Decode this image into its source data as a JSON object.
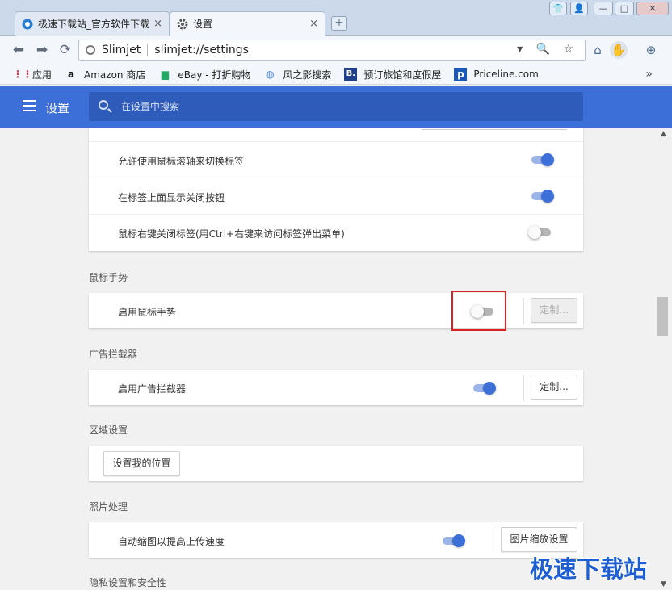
{
  "window": {
    "tabs": [
      {
        "title": "极速下载站_官方软件下载",
        "close": "×"
      },
      {
        "title": "设置",
        "close": "×"
      }
    ],
    "new_tab": "+",
    "controls": {
      "shirt": "👕",
      "user": "👤",
      "minimize": "—",
      "maximize": "□",
      "close": "✕"
    }
  },
  "toolbar": {
    "back": "⬅",
    "forward": "➡",
    "reload": "⟳",
    "site_name": "Slimjet",
    "url": "slimjet://settings",
    "omni_icons": "▾ 🔍 ☆",
    "home": "⌂",
    "hand": "✋",
    "globe": "⊕"
  },
  "bookmarks": {
    "items": [
      {
        "icon": "apps-grid-icon",
        "glyph": "⋮⋮",
        "label": "应用"
      },
      {
        "icon": "amazon-icon",
        "glyph": "a",
        "label": "Amazon 商店"
      },
      {
        "icon": "ebay-bag-icon",
        "glyph": "▆",
        "label": "eBay - 打折购物"
      },
      {
        "icon": "globe-icon",
        "glyph": "◍",
        "label": "风之影搜索"
      },
      {
        "icon": "booking-icon",
        "glyph": "B.",
        "label": "预订旅馆和度假屋"
      },
      {
        "icon": "priceline-icon",
        "glyph": "p",
        "label": "Priceline.com"
      }
    ],
    "more": "»"
  },
  "header": {
    "title": "设置",
    "search_placeholder": "在设置中搜索"
  },
  "tab_settings": {
    "rows": [
      {
        "label": "允许使用鼠标滚轴来切换标签",
        "enabled": true
      },
      {
        "label": "在标签上面显示关闭按钮",
        "enabled": true
      },
      {
        "label": "鼠标右键关闭标签(用Ctrl+右键来访问标签弹出菜单)",
        "enabled": false
      }
    ]
  },
  "mouse_gestures": {
    "title": "鼠标手势",
    "label": "启用鼠标手势",
    "enabled": false,
    "button": "定制..."
  },
  "ad_blocker": {
    "title": "广告拦截器",
    "label": "启用广告拦截器",
    "enabled": true,
    "button": "定制..."
  },
  "region": {
    "title": "区域设置",
    "button": "设置我的位置"
  },
  "photo": {
    "title": "照片处理",
    "label": "自动缩图以提高上传速度",
    "enabled": true,
    "button": "图片缩放设置"
  },
  "privacy": {
    "title": "隐私设置和安全性"
  },
  "scrollbar": {
    "up": "▲",
    "down": "▼"
  },
  "watermark": "极速下载站",
  "colors": {
    "accent": "#3c6fd8",
    "highlight": "#e02020"
  }
}
